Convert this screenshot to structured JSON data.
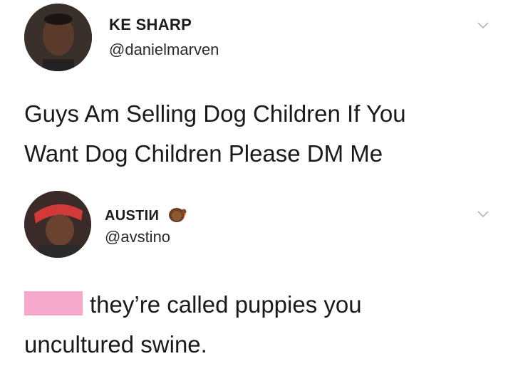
{
  "tweets": [
    {
      "display_name": "KE SHARP",
      "handle": "@danielmarven",
      "text_line1": "Guys Am Selling Dog Children If You",
      "text_line2": "Want Dog Children Please DM Me"
    },
    {
      "display_name": "AUSTIИ",
      "handle": "@avstino",
      "text_line1": "they’re called puppies you",
      "text_line2": "uncultured swine."
    }
  ],
  "icons": {
    "menu": "chevron-down-icon",
    "emoji": "turkey-icon"
  },
  "colors": {
    "redaction": "#f7a9cc",
    "chevron": "#b4b4b4"
  }
}
